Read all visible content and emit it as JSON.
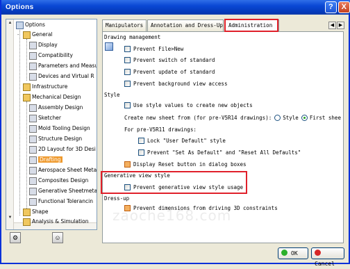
{
  "window": {
    "title": "Options",
    "help_label": "?",
    "close_label": "X"
  },
  "tree": {
    "items": [
      {
        "label": "Options"
      },
      {
        "label": "General"
      },
      {
        "label": "Display"
      },
      {
        "label": "Compatibility"
      },
      {
        "label": "Parameters and Measur"
      },
      {
        "label": "Devices and Virtual R"
      },
      {
        "label": "Infrastructure"
      },
      {
        "label": "Mechanical Design"
      },
      {
        "label": "Assembly Design"
      },
      {
        "label": "Sketcher"
      },
      {
        "label": "Mold Tooling Design"
      },
      {
        "label": "Structure Design"
      },
      {
        "label": "2D Layout for 3D Desi"
      },
      {
        "label": "Drafting"
      },
      {
        "label": "Aerospace Sheet Metal"
      },
      {
        "label": "Composites Design"
      },
      {
        "label": "Generative Sheetmetal"
      },
      {
        "label": "Functional Tolerancin"
      },
      {
        "label": "Shape"
      },
      {
        "label": "Analysis & Simulation"
      }
    ]
  },
  "tabs": [
    {
      "label": "Manipulators"
    },
    {
      "label": "Annotation and Dress-Up"
    },
    {
      "label": "Administration"
    }
  ],
  "sections": {
    "drawing_management": "Drawing management",
    "style": "Style",
    "generative_view_style": "Generative view style",
    "dress_up": "Dress-up"
  },
  "options": {
    "prevent_file_new": "Prevent File>New",
    "prevent_switch": "Prevent switch of standard",
    "prevent_update": "Prevent update of standard",
    "prevent_background": "Prevent background view access",
    "use_style_values": "Use style values to create new objects",
    "create_new_sheet": "Create new sheet from (for pre-V5R14 drawings):",
    "radio_style": "Style",
    "radio_first_sheet": "First shee",
    "for_pre_v5r11": "For pre-V5R11 drawings:",
    "lock_user_default": "Lock \"User Default\" style",
    "prevent_set_as_default": "Prevent \"Set As Default\" and \"Reset All Defaults\"",
    "display_reset": "Display Reset button in dialog boxes",
    "prevent_generative": "Prevent generative view style usage",
    "prevent_dimensions": "Prevent dimensions from driving 3D constraints"
  },
  "buttons": {
    "ok": "OK",
    "cancel": "Cancel"
  },
  "watermark": "zaoche168.com"
}
